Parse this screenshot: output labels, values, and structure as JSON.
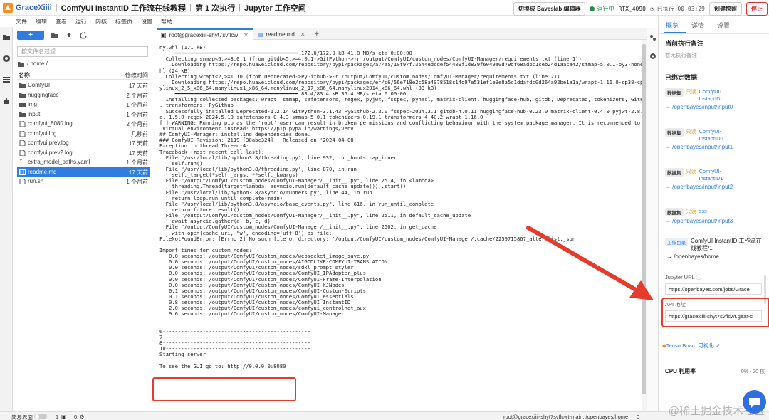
{
  "header": {
    "app_name": "GraceXiiii",
    "crumbs": [
      "ComfyUI InstantID 工作流在线教程",
      "第 1 次执行",
      "Jupyter 工作空间"
    ],
    "switch_button": "切换成 Bayeslab 编辑器",
    "status": "运行中",
    "gpu": "RTX_4090",
    "elapsed": "已执行 00:03:29",
    "snapshot_button": "创建快照",
    "stop_button": "停止"
  },
  "menu": [
    "文件",
    "编辑",
    "查看",
    "运行",
    "内核",
    "标签页",
    "设置",
    "帮助"
  ],
  "filebrowser": {
    "new_label": "+",
    "search_placeholder": "按文件名过滤",
    "path": "/ home /",
    "col_name": "名称",
    "col_modified": "修改时间",
    "files": [
      {
        "name": "ComfyUI",
        "modified": "17 天前",
        "type": "folder"
      },
      {
        "name": "huggingface",
        "modified": "2 个月前",
        "type": "folder"
      },
      {
        "name": "img",
        "modified": "1 个月前",
        "type": "folder"
      },
      {
        "name": "input",
        "modified": "1 个月前",
        "type": "folder"
      },
      {
        "name": "comfyui_8080.log",
        "modified": "2 个月前",
        "type": "file"
      },
      {
        "name": "comfyui.log",
        "modified": "几秒前",
        "type": "file"
      },
      {
        "name": "comfyui.prev.log",
        "modified": "17 天前",
        "type": "file"
      },
      {
        "name": "comfyui.prev2.log",
        "modified": "17 天前",
        "type": "file"
      },
      {
        "name": "extra_model_paths.yaml",
        "modified": "1 个月前",
        "type": "yaml"
      },
      {
        "name": "readme.md",
        "modified": "17 天前",
        "type": "md",
        "selected": true
      },
      {
        "name": "run.sh",
        "modified": "1 个月前",
        "type": "file"
      }
    ]
  },
  "tabs": [
    {
      "label": "root@gracexiiii-shyt7svflcw",
      "active": true
    },
    {
      "label": "readme.md",
      "active": false
    }
  ],
  "terminal_lines": [
    "ny.whl (171 kB)",
    "     ━━━━━━━━━━━━━━━━━━━━━━━━━━━━━━━━━━━━━━━━ 172.0/172.0 kB 41.8 MB/s eta 0:00:00",
    "  Collecting smmap<6,>=3.0.1 (from gitdb<5,>=4.0.1->GitPython->-r /output/ComfyUI/custom_nodes/ComfyUI-Manager/requirements.txt (line 1))",
    "    Downloading https://repo.huaweicloud.com/repository/pypi/packages/a7/a5/10f97f73544edcdef54409f1d839f6049a0d79df68adbc1ceb24d1aaca42/smmap-5.0.1-py3-none-any.w",
    "hl (24 kB)",
    "  Collecting wrapt<2,>=1.10 (from Deprecated->PyGithub->-r /output/ComfyUI/custom_nodes/ComfyUI-Manager/requirements.txt (line 2))",
    "    Downloading https://repo.huaweicloud.com/repository/pypi/packages/ef/c6/56e718e2c58a4078518c14d97e531ef1e9e8a5c1ddafdc0d264a92be1a1a/wrapt-1.16.0-cp38-cp38-man",
    "ylinux_2_5_x86_64.manylinux1_x86_64.manylinux_2_17_x86_64.manylinux2014_x86_64.whl (83 kB)",
    "     ━━━━━━━━━━━━━━━━━━━━━━━━━━━━━━━━━━━━━━━━ 83.4/83.4 kB 35.4 MB/s eta 0:00:00",
    "  Installing collected packages: wrapt, smmap, safetensors, regex, pyjwt, fsspec, pynacl, matrix-client, huggingface-hub, gitdb, Deprecated, tokenizers, GitPython",
    ", transformers, PyGithub",
    "  Successfully installed Deprecated-1.2.14 GitPython-3.1.43 PyGithub-2.3.0 fsspec-2024.3.1 gitdb-4.0.11 huggingface-hub-0.23.0 matrix-client-0.4.0 pyjwt-2.8.0 pyna",
    "cl-1.5.0 regex-2024.5.10 safetensors-0.4.3 smmap-5.0.1 tokenizers-0.19.1 transformers-4.40.2 wrapt-1.16.0",
    "[!] WARNING: Running pip as the 'root' user can result in broken permissions and conflicting behaviour with the system package manager. It is recommended to use a",
    " virtual environment instead: https://pip.pypa.io/warnings/venv",
    "## ComfyUI-Manager: installing dependencies done.",
    "### ComfyUI Revision: 2119 [30abc324] | Released on '2024-04-08'",
    "Exception in thread Thread-4:",
    "Traceback (most recent call last):",
    "  File \"/usr/local/lib/python3.8/threading.py\", line 932, in _bootstrap_inner",
    "    self.run()",
    "  File \"/usr/local/lib/python3.8/threading.py\", line 870, in run",
    "    self._target(*self._args, **self._kwargs)",
    "  File \"/output/ComfyUI/custom_nodes/ComfyUI-Manager/__init__.py\", line 2514, in <lambda>",
    "    threading.Thread(target=lambda: asyncio.run(default_cache_update())).start()",
    "  File \"/usr/local/lib/python3.8/asyncio/runners.py\", line 44, in run",
    "    return loop.run_until_complete(main)",
    "  File \"/usr/local/lib/python3.8/asyncio/base_events.py\", line 616, in run_until_complete",
    "    return future.result()",
    "  File \"/output/ComfyUI/custom_nodes/ComfyUI-Manager/__init__.py\", line 2511, in default_cache_update",
    "    await asyncio.gather(a, b, c, d)",
    "  File \"/output/ComfyUI/custom_nodes/ComfyUI-Manager/__init__.py\", line 2502, in get_cache",
    "    with open(cache_uri, \"w\", encoding='utf-8') as file:",
    "FileNotFoundError: [Errno 2] No such file or directory: '/output/ComfyUI/custom_nodes/ComfyUI-Manager/.cache/2259715867_alter-list.json'",
    "",
    "Import times for custom nodes:",
    "   0.0 seconds: /output/ComfyUI/custom_nodes/websocket_image_save.py",
    "   0.0 seconds: /output/ComfyUI/custom_nodes/AIGODLIKE-COMFYUI-TRANSLATION",
    "   0.0 seconds: /output/ComfyUI/custom_nodes/sdxl_prompt_styler",
    "   0.0 seconds: /output/ComfyUI/custom_nodes/ComfyUI_IPAdapter_plus",
    "   0.0 seconds: /output/ComfyUI/custom_nodes/ComfyUI-Frame-Interpolation",
    "   0.0 seconds: /output/ComfyUI/custom_nodes/ComfyUI-KJNodes",
    "   0.1 seconds: /output/ComfyUI/custom_nodes/ComfyUI-Custom-Scripts",
    "   0.1 seconds: /output/ComfyUI/custom_nodes/ComfyUI_essentials",
    "   0.8 seconds: /output/ComfyUI/custom_nodes/ComfyUI_InstantID",
    "   2.0 seconds: /output/ComfyUI/custom_nodes/comfyui_controlnet_aux",
    "   9.6 seconds: /output/ComfyUI/custom_nodes/ComfyUI-Manager",
    "",
    "",
    "6------------------------------------------------",
    "7------------------------------------------------",
    "8------------------------------------------------",
    "10-----------------------------------------------",
    "Starting server",
    "",
    "To see the GUI go to: http://0.0.0.0:8080"
  ],
  "right_panel": {
    "tabs": [
      "概览",
      "详情",
      "设置"
    ],
    "note_title": "当前执行备注",
    "note_empty": "暂无执行备注",
    "bound_title": "已绑定数据",
    "datasets": [
      {
        "badge": "数据集",
        "ro": "只读",
        "name": "ComfyUI-InstantID",
        "path": "→ /openbayes/input/input0"
      },
      {
        "badge": "数据集",
        "ro": "只读",
        "name": "ComfyUI-InstantID0",
        "path": "→ /openbayes/input/input1"
      },
      {
        "badge": "数据集",
        "ro": "只读",
        "name": "ComfyUI-InstantID1",
        "path": "→ /openbayes/input/input2"
      },
      {
        "badge": "数据集",
        "ro": "只读",
        "name": "sss",
        "path": "→ /openbayes/input/input3"
      }
    ],
    "workdir": {
      "badge": "工作目录",
      "name": "ComfyUI InstantID 工作流在线教程/1",
      "path": "→ /openbayes/home"
    },
    "jupyter_label": "Jupyter URL",
    "jupyter_url": "https://openbayes.com/jobs/Grace",
    "api_label": "API 地址",
    "api_url": "https://gracexiiii-shyt7svflcwt.gear-c",
    "tensorboard": "TensorBoard 可视化",
    "cpu_label": "CPU 利用率",
    "cpu_range": "0% - 20 核"
  },
  "statusbar": {
    "simple": "简易界面",
    "count1": "1",
    "count2": "0",
    "host": "root@gracexiiii-shyt7svflcwt-main: /openbayes/home",
    "num": "0"
  },
  "watermark": "@稀土掘金技术社区",
  "colors": {
    "accent": "#2f7de1",
    "danger": "#e53b2c",
    "running": "#1d8f49"
  }
}
